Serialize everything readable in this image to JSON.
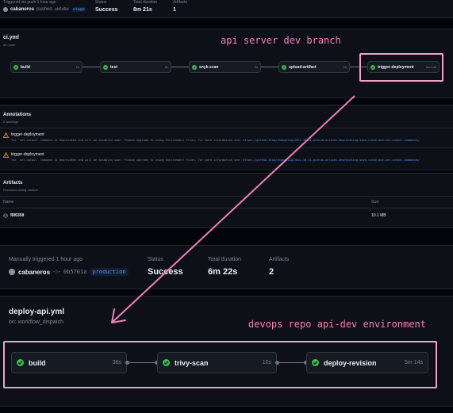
{
  "top_summary": {
    "triggered_label": "Triggered via push 1 hour ago",
    "user": "cabaneros",
    "action": "pushed",
    "commit": "ab6d8d",
    "branch": "stage",
    "status_label": "Status",
    "status_value": "Success",
    "duration_label": "Total duration",
    "duration_value": "8m 21s",
    "artifacts_label": "Artifacts",
    "artifacts_value": "1"
  },
  "ci_workflow": {
    "filename": "ci.yml",
    "trigger": "on: push",
    "jobs": [
      {
        "name": "build",
        "duration": "1s"
      },
      {
        "name": "test",
        "duration": "2s"
      },
      {
        "name": "snyk-scan",
        "duration": "2s"
      },
      {
        "name": "upload-artifact",
        "duration": "1s"
      },
      {
        "name": "trigger-deployment",
        "duration": "5m 14s"
      }
    ]
  },
  "annotations": {
    "title": "Annotations",
    "subtitle": "2 warnings",
    "items": [
      {
        "job": "trigger-deployment",
        "message": "The `set-output` command is deprecated and will be disabled soon. Please upgrade to using Environment Files. For more information see:",
        "link": "https://github.blog/changelog/2022-10-11-github-actions-deprecating-save-state-and-set-output-commands/"
      },
      {
        "job": "trigger-deployment",
        "message": "The `set-output` command is deprecated and will be disabled soon. Please upgrade to using Environment Files. For more information see:",
        "link": "https://github.blog/changelog/2022-10-11-github-actions-deprecating-save-state-and-set-output-commands/"
      }
    ]
  },
  "artifacts": {
    "title": "Artifacts",
    "subtitle": "Produced during runtime",
    "col_name": "Name",
    "col_size": "Size",
    "rows": [
      {
        "name": "f8f6358",
        "size": "10.1 MB"
      }
    ]
  },
  "deploy_summary": {
    "triggered_label": "Manually triggered 1 hour ago",
    "user": "cabaneros",
    "commit": "0b5761a",
    "environment": "production",
    "status_label": "Status",
    "status_value": "Success",
    "duration_label": "Total duration",
    "duration_value": "6m 22s",
    "artifacts_label": "Artifacts",
    "artifacts_value": "2"
  },
  "deploy_workflow": {
    "filename": "deploy-api.yml",
    "trigger": "on: workflow_dispatch",
    "jobs": [
      {
        "name": "build",
        "duration": "36s"
      },
      {
        "name": "trivy-scan",
        "duration": "10s"
      },
      {
        "name": "deploy-revision",
        "duration": "5m 14s"
      }
    ]
  },
  "annotations_overlay": {
    "top_label": "api server dev branch",
    "bottom_label": "devops repo api-dev environment",
    "color": "#f27fbd"
  },
  "colors": {
    "success": "#3fb950",
    "background": "#0d1117",
    "page": "#010409",
    "link": "#4493f8",
    "warning": "#d29922"
  }
}
